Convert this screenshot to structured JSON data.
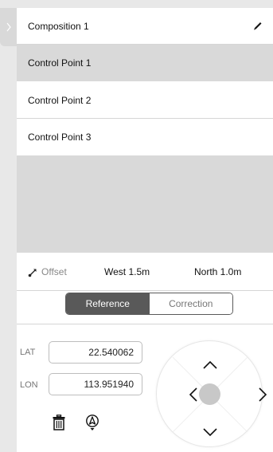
{
  "sidebar_toggle": {
    "icon": "chevron-right-icon"
  },
  "composition": {
    "title": "Composition 1",
    "edit_icon": "pencil-icon"
  },
  "control_points": [
    {
      "label": "Control Point 1",
      "selected": true
    },
    {
      "label": "Control Point 2",
      "selected": false
    },
    {
      "label": "Control Point 3",
      "selected": false
    }
  ],
  "offset": {
    "icon": "offset-arrow-icon",
    "label": "Offset",
    "west": "West 1.5m",
    "north": "North 1.0m"
  },
  "mode_toggle": {
    "options": [
      "Reference",
      "Correction"
    ],
    "selected": "Reference"
  },
  "coordinates": {
    "lat_label": "LAT",
    "lat_value": "22.540062",
    "lon_label": "LON",
    "lon_value": "113.951940"
  },
  "tools": {
    "delete_icon": "trash-icon",
    "locate_icon": "aircraft-location-icon"
  },
  "dpad": {
    "up_icon": "chevron-up-icon",
    "down_icon": "chevron-down-icon",
    "left_icon": "chevron-left-icon",
    "right_icon": "chevron-right-icon",
    "center_icon": "center-dot-icon"
  },
  "colors": {
    "selected_row": "#d9d9d9",
    "active_segment": "#595959",
    "divider": "#d6d6d6"
  }
}
